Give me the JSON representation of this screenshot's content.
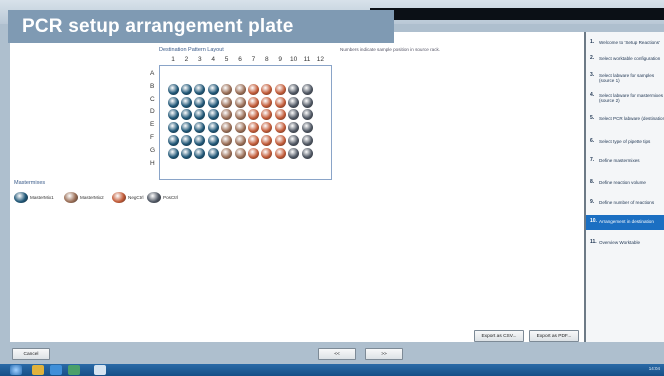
{
  "banner": {
    "title": "PCR setup arrangement plate"
  },
  "plate": {
    "title": "Destination Pattern Layout",
    "note": "Numbers indicate sample position in source rack.",
    "columns": [
      "1",
      "2",
      "3",
      "4",
      "5",
      "6",
      "7",
      "8",
      "9",
      "10",
      "11",
      "12"
    ],
    "rows": [
      "A",
      "B",
      "C",
      "D",
      "E",
      "F",
      "G",
      "H"
    ]
  },
  "legend": {
    "title": "Mastermixes",
    "items": [
      {
        "label": "MasterMix1",
        "color": "#1f5676"
      },
      {
        "label": "MasterMix2",
        "color": "#9a6e56"
      },
      {
        "label": "NegCtrl",
        "color": "#c25b38"
      },
      {
        "label": "PosCtrl",
        "color": "#4f5763"
      }
    ]
  },
  "wells": {
    "B": [
      "m1",
      "m1",
      "m1",
      "m1",
      "m2",
      "m2",
      "neg",
      "neg",
      "neg",
      "pos",
      "pos"
    ],
    "C": [
      "m1",
      "m1",
      "m1",
      "m1",
      "m2",
      "m2",
      "neg",
      "neg",
      "neg",
      "pos",
      "pos"
    ],
    "D": [
      "m1",
      "m1",
      "m1",
      "m1",
      "m2",
      "m2",
      "neg",
      "neg",
      "neg",
      "pos",
      "pos"
    ],
    "E": [
      "m1",
      "m1",
      "m1",
      "m1",
      "m2",
      "m2",
      "neg",
      "neg",
      "neg",
      "pos",
      "pos"
    ],
    "F": [
      "m1",
      "m1",
      "m1",
      "m1",
      "m2",
      "m2",
      "neg",
      "neg",
      "neg",
      "pos",
      "pos"
    ],
    "G": [
      "m1",
      "m1",
      "m1",
      "m1",
      "m2",
      "m2",
      "neg",
      "neg",
      "neg",
      "pos",
      "pos"
    ]
  },
  "sidebar": {
    "items": [
      {
        "num": "1.",
        "label": "Welcome to 'Setup Reactions'"
      },
      {
        "num": "2.",
        "label": "Select worktable configuration"
      },
      {
        "num": "3.",
        "label": "Select labware for samples (source 1)"
      },
      {
        "num": "4.",
        "label": "Select labware for mastermixes (source 2)"
      },
      {
        "num": "5.",
        "label": "Select PCR labware (destination)"
      },
      {
        "num": "6.",
        "label": "Select type of pipette tips"
      },
      {
        "num": "7.",
        "label": "Define mastermixes"
      },
      {
        "num": "8.",
        "label": "Define reaction volume"
      },
      {
        "num": "9.",
        "label": "Define number of reactions"
      },
      {
        "num": "10.",
        "label": "Arrangement in destination"
      },
      {
        "num": "11.",
        "label": "Overview Worktable"
      }
    ],
    "active_index": 9
  },
  "buttons": {
    "export_csv": "Export as CSV...",
    "export_pdf": "Export as PDF...",
    "cancel": "Cancel",
    "back": "<<",
    "next": ">>"
  },
  "taskbar": {
    "time": "14:04"
  }
}
